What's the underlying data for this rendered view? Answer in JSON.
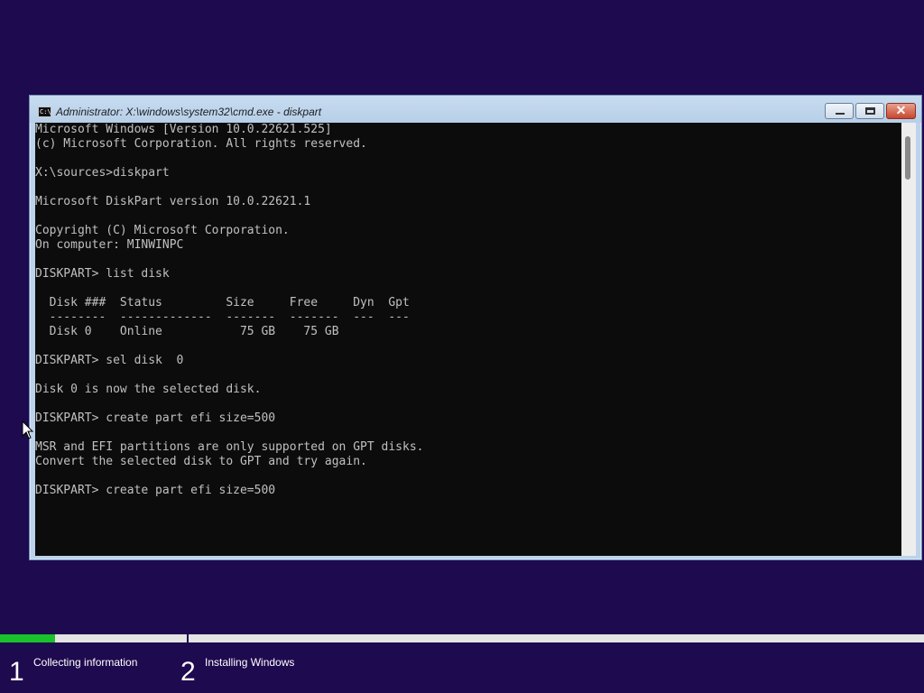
{
  "window": {
    "title": "Administrator: X:\\windows\\system32\\cmd.exe - diskpart",
    "icon_text": "C:\\"
  },
  "console": {
    "lines": [
      "Microsoft Windows [Version 10.0.22621.525]",
      "(c) Microsoft Corporation. All rights reserved.",
      "",
      "X:\\sources>diskpart",
      "",
      "Microsoft DiskPart version 10.0.22621.1",
      "",
      "Copyright (C) Microsoft Corporation.",
      "On computer: MINWINPC",
      "",
      "DISKPART> list disk",
      "",
      "  Disk ###  Status         Size     Free     Dyn  Gpt",
      "  --------  -------------  -------  -------  ---  ---",
      "  Disk 0    Online           75 GB    75 GB",
      "",
      "DISKPART> sel disk  0",
      "",
      "Disk 0 is now the selected disk.",
      "",
      "DISKPART> create part efi size=500",
      "",
      "MSR and EFI partitions are only supported on GPT disks.",
      "Convert the selected disk to GPT and try again.",
      "",
      "DISKPART> create part efi size=500"
    ]
  },
  "setup": {
    "progress_fraction": 0.06,
    "steps": [
      {
        "number": "1",
        "label": "Collecting information"
      },
      {
        "number": "2",
        "label": "Installing Windows"
      }
    ]
  },
  "colors": {
    "background": "#1e0a4e",
    "progress_fill": "#19c22a",
    "console_bg": "#0c0c0c",
    "console_text": "#c0c0c0"
  }
}
